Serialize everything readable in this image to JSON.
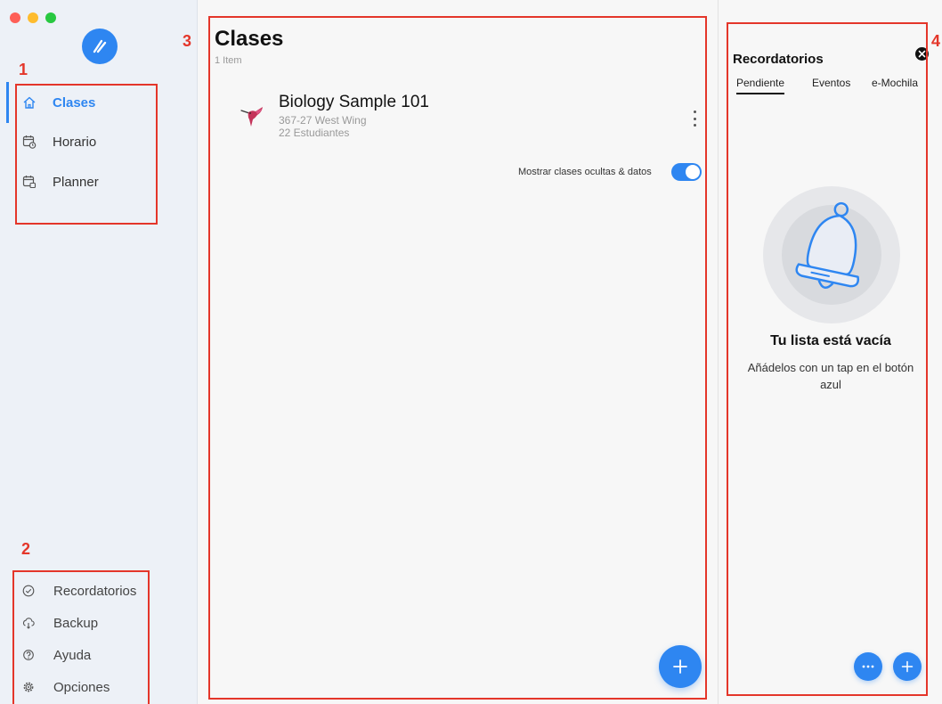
{
  "sidebar": {
    "nav": [
      {
        "label": "Clases",
        "icon": "home-icon",
        "active": true
      },
      {
        "label": "Horario",
        "icon": "calendar-clock-icon",
        "active": false
      },
      {
        "label": "Planner",
        "icon": "calendar-planner-icon",
        "active": false
      }
    ],
    "bottom": [
      {
        "label": "Recordatorios",
        "icon": "check-circle-icon"
      },
      {
        "label": "Backup",
        "icon": "cloud-sync-icon"
      },
      {
        "label": "Ayuda",
        "icon": "help-circle-icon"
      },
      {
        "label": "Opciones",
        "icon": "gear-icon"
      }
    ]
  },
  "main": {
    "title": "Clases",
    "count": "1 Item",
    "classes": [
      {
        "name": "Biology Sample 101",
        "room": "367-27 West Wing",
        "students": "22 Estudiantes",
        "icon": "hummingbird-icon"
      }
    ],
    "toggle": {
      "label": "Mostrar clases ocultas & datos",
      "on": true
    },
    "fab_label": "+"
  },
  "reminders": {
    "title": "Recordatorios",
    "tabs": [
      {
        "label": "Pendiente",
        "active": true
      },
      {
        "label": "Eventos",
        "active": false
      },
      {
        "label": "e-Mochila",
        "active": false
      }
    ],
    "empty_title": "Tu lista está vacía",
    "empty_subtitle": "Añádelos con un tap en el botón azul",
    "more_label": "···",
    "add_label": "+"
  },
  "annotations": [
    "1",
    "2",
    "3",
    "4"
  ],
  "colors": {
    "accent": "#2e86f1",
    "annotation": "#e4362a",
    "sidebar_bg": "#edf1f7",
    "panel_bg": "#f7f7f7"
  }
}
